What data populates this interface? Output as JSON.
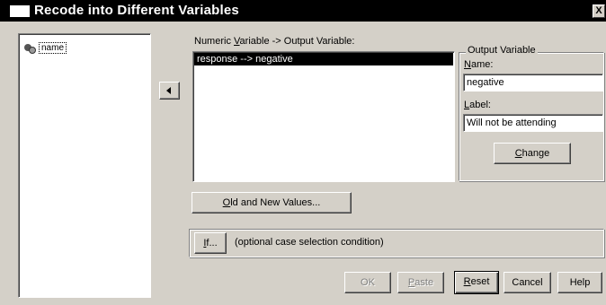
{
  "window": {
    "title": "Recode into Different Variables",
    "close_glyph": "X"
  },
  "source_list": {
    "items": [
      {
        "label": "name",
        "icon": "string-variable-icon"
      }
    ]
  },
  "mapping": {
    "label_pre": "Numeric ",
    "label_mnemonic": "V",
    "label_post": "ariable -> Output Variable:",
    "rows": [
      "response --> negative"
    ]
  },
  "output_variable": {
    "group_title": "Output Variable",
    "name_mnemonic": "N",
    "name_rest": "ame:",
    "name_value": "negative",
    "label_mnemonic": "L",
    "label_rest": "abel:",
    "label_value": "Will not be attending",
    "change_mnemonic": "C",
    "change_rest": "hange"
  },
  "old_new": {
    "mnemonic": "O",
    "rest": "ld and New Values..."
  },
  "condition": {
    "if_mnemonic": "I",
    "if_rest": "f...",
    "hint": "(optional case selection condition)"
  },
  "footer": {
    "ok": "OK",
    "paste_mnemonic": "P",
    "paste_rest": "aste",
    "reset_mnemonic": "R",
    "reset_rest": "eset",
    "cancel": "Cancel",
    "help": "Help"
  },
  "colors": {
    "dialog_face": "#d4d0c8",
    "titlebar": "#000000",
    "selection": "#000000"
  }
}
